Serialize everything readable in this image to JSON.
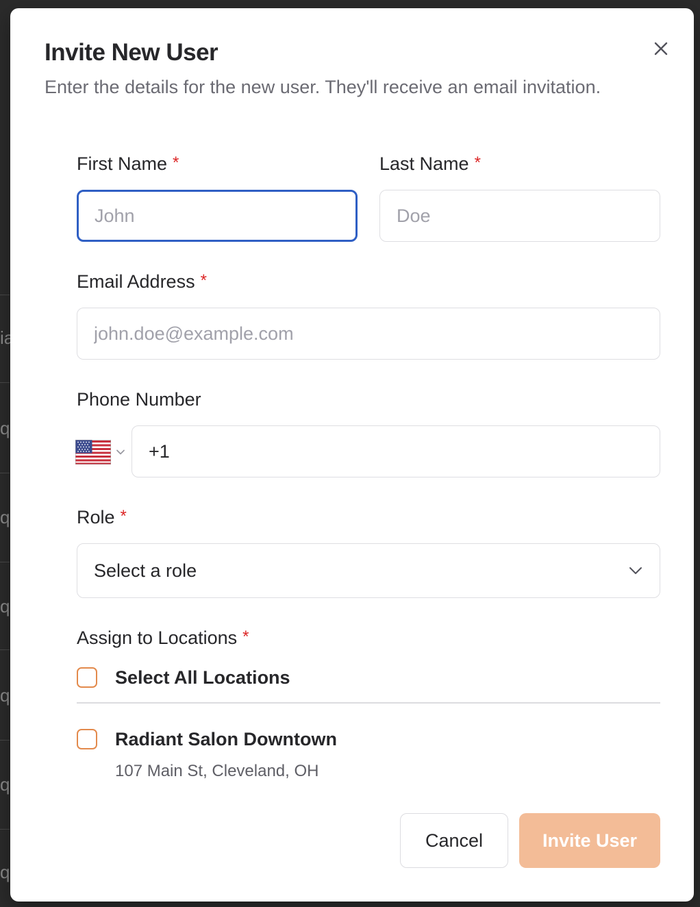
{
  "background": {
    "peek_chars": [
      "ia",
      "q",
      "q",
      "q",
      "q",
      "q",
      "q"
    ]
  },
  "dialog": {
    "title": "Invite New User",
    "subtitle": "Enter the details for the new user. They'll receive an email invitation.",
    "close_icon": "close-icon"
  },
  "form": {
    "required_mark": "*",
    "first_name": {
      "label": "First Name",
      "placeholder": "John",
      "value": ""
    },
    "last_name": {
      "label": "Last Name",
      "placeholder": "Doe",
      "value": ""
    },
    "email": {
      "label": "Email Address",
      "placeholder": "john.doe@example.com",
      "value": ""
    },
    "phone": {
      "label": "Phone Number",
      "country_flag": "us-flag-icon",
      "value": "+1"
    },
    "role": {
      "label": "Role",
      "selected": "Select a role"
    },
    "locations": {
      "label": "Assign to Locations",
      "select_all_label": "Select All Locations",
      "items": [
        {
          "name": "Radiant Salon Downtown",
          "address": "107 Main St, Cleveland, OH",
          "checked": false
        }
      ]
    }
  },
  "actions": {
    "cancel_label": "Cancel",
    "invite_label": "Invite User"
  },
  "colors": {
    "focus_border": "#2f5fc4",
    "required": "#dc2626",
    "checkbox_border": "#e38a4c",
    "invite_button_disabled": "#f3bc97"
  }
}
